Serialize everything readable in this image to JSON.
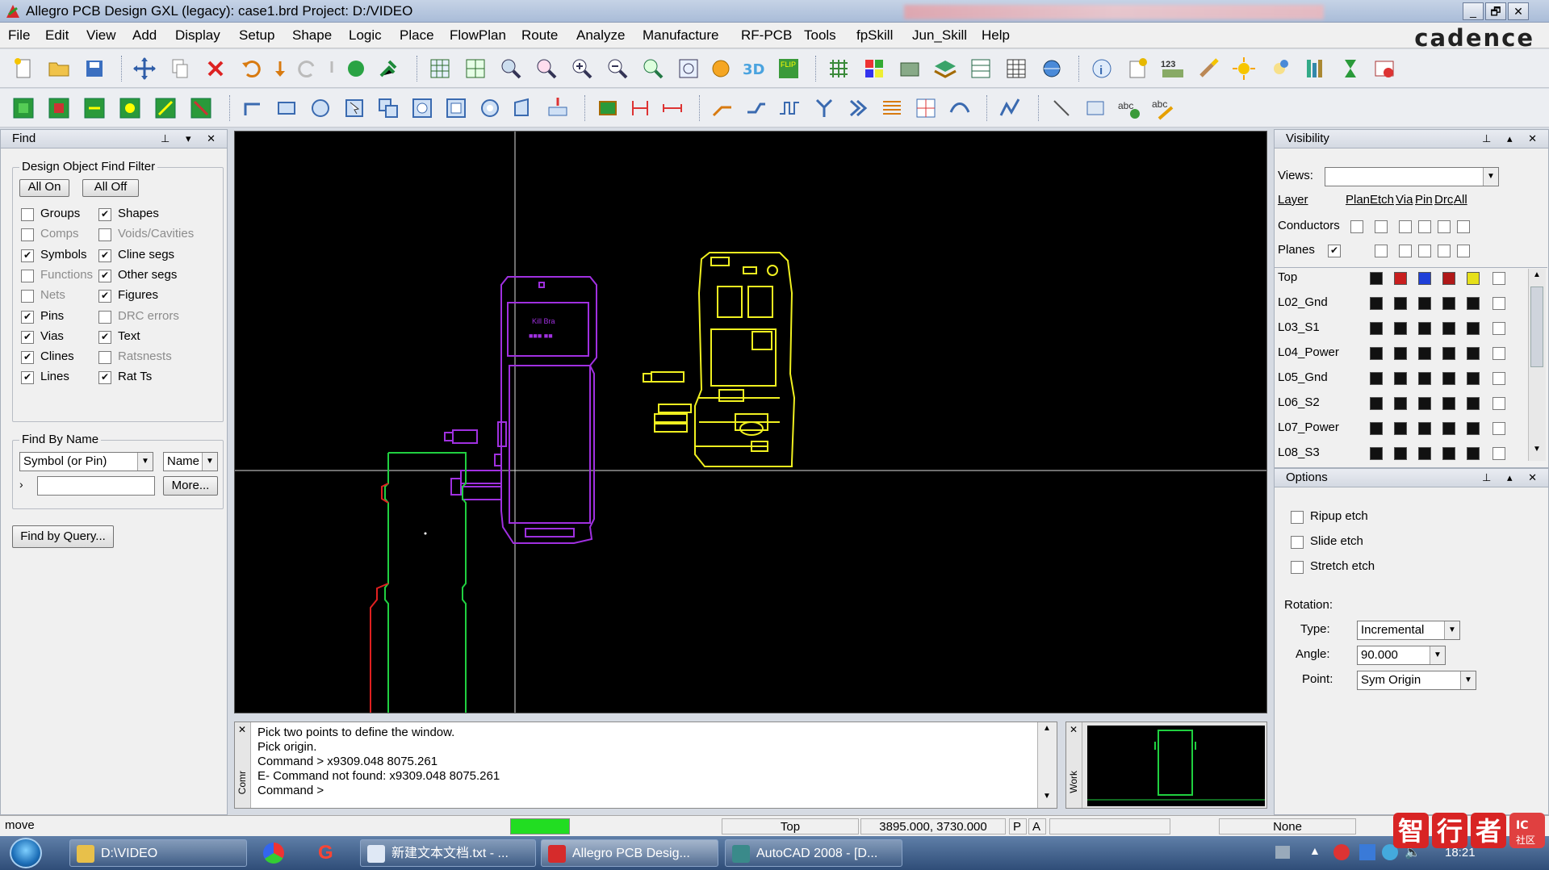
{
  "window": {
    "title": "Allegro PCB Design GXL (legacy): case1.brd  Project: D:/VIDEO",
    "icon": "allegro-icon",
    "controls": [
      "_",
      "🗗",
      "✕"
    ]
  },
  "menubar": {
    "items": [
      "File",
      "Edit",
      "View",
      "Add",
      "Display",
      "Setup",
      "Shape",
      "Logic",
      "Place",
      "FlowPlan",
      "Route",
      "Analyze",
      "Manufacture",
      "RF-PCB",
      "Tools",
      "fpSkill",
      "Jun_Skill",
      "Help"
    ],
    "brand": "cadence"
  },
  "find_panel": {
    "title": "Find",
    "filter_group": "Design Object Find Filter",
    "all_on": "All On",
    "all_off": "All Off",
    "left_items": [
      {
        "label": "Groups",
        "checked": false,
        "enabled": true
      },
      {
        "label": "Comps",
        "checked": false,
        "enabled": false
      },
      {
        "label": "Symbols",
        "checked": true,
        "enabled": true
      },
      {
        "label": "Functions",
        "checked": false,
        "enabled": false
      },
      {
        "label": "Nets",
        "checked": false,
        "enabled": false
      },
      {
        "label": "Pins",
        "checked": true,
        "enabled": true
      },
      {
        "label": "Vias",
        "checked": true,
        "enabled": true
      },
      {
        "label": "Clines",
        "checked": true,
        "enabled": true
      },
      {
        "label": "Lines",
        "checked": true,
        "enabled": true
      }
    ],
    "right_items": [
      {
        "label": "Shapes",
        "checked": true,
        "enabled": true
      },
      {
        "label": "Voids/Cavities",
        "checked": false,
        "enabled": false
      },
      {
        "label": "Cline segs",
        "checked": true,
        "enabled": true
      },
      {
        "label": "Other segs",
        "checked": true,
        "enabled": true
      },
      {
        "label": "Figures",
        "checked": true,
        "enabled": true
      },
      {
        "label": "DRC errors",
        "checked": false,
        "enabled": false
      },
      {
        "label": "Text",
        "checked": true,
        "enabled": true
      },
      {
        "label": "Ratsnests",
        "checked": false,
        "enabled": false
      },
      {
        "label": "Rat Ts",
        "checked": true,
        "enabled": true
      }
    ],
    "by_name_group": "Find By Name",
    "type_select": "Symbol (or Pin)",
    "name_select": "Name",
    "name_input": "",
    "more_button": "More...",
    "query_button": "Find by Query..."
  },
  "visibility_panel": {
    "title": "Visibility",
    "views_label": "Views:",
    "views_value": "",
    "columns": [
      "Layer",
      "Plan",
      "Etch",
      "Via",
      "Pin",
      "Drc",
      "All"
    ],
    "conductors_label": "Conductors",
    "planes_label": "Planes",
    "layers": [
      {
        "name": "Top",
        "colors": [
          "#111111",
          "#c81e1e",
          "#1f3fd8",
          "#b01818",
          "#e6e01a"
        ]
      },
      {
        "name": "L02_Gnd",
        "colors": [
          "#111111",
          "#111111",
          "#111111",
          "#111111",
          "#111111"
        ]
      },
      {
        "name": "L03_S1",
        "colors": [
          "#111111",
          "#111111",
          "#111111",
          "#111111",
          "#111111"
        ]
      },
      {
        "name": "L04_Power",
        "colors": [
          "#111111",
          "#111111",
          "#111111",
          "#111111",
          "#111111"
        ]
      },
      {
        "name": "L05_Gnd",
        "colors": [
          "#111111",
          "#111111",
          "#111111",
          "#111111",
          "#111111"
        ]
      },
      {
        "name": "L06_S2",
        "colors": [
          "#111111",
          "#111111",
          "#111111",
          "#111111",
          "#111111"
        ]
      },
      {
        "name": "L07_Power",
        "colors": [
          "#111111",
          "#111111",
          "#111111",
          "#111111",
          "#111111"
        ]
      },
      {
        "name": "L08_S3",
        "colors": [
          "#111111",
          "#111111",
          "#111111",
          "#111111",
          "#111111"
        ]
      }
    ]
  },
  "options_panel": {
    "title": "Options",
    "checks": [
      "Ripup etch",
      "Slide etch",
      "Stretch etch"
    ],
    "rotation_label": "Rotation:",
    "type_label": "Type:",
    "type_value": "Incremental",
    "angle_label": "Angle:",
    "angle_value": "90.000",
    "point_label": "Point:",
    "point_value": "Sym Origin"
  },
  "command": {
    "side_label": "Comr",
    "lines": [
      "Pick two points to define the window.",
      "Pick origin.",
      "Command > x9309.048 8075.261",
      "E- Command not found: x9309.048 8075.261",
      "Command >"
    ],
    "world_label": "Work"
  },
  "status": {
    "mode": "move",
    "indicator_color": "#22dd22",
    "layer": "Top",
    "coords": "3895.000, 3730.000",
    "p_flag": "P",
    "a_flag": "A",
    "dynamic": "None"
  },
  "taskbar": {
    "items": [
      {
        "label": "D:\\VIDEO",
        "active": false
      },
      {
        "label": "新建文本文档.txt - ...",
        "active": false
      },
      {
        "label": "Allegro PCB Desig...",
        "active": true
      },
      {
        "label": "AutoCAD 2008 - [D...",
        "active": false
      }
    ],
    "clock": "18:21",
    "watermark": [
      "智",
      "行",
      "者",
      "IC社区"
    ]
  },
  "colors": {
    "canvas_bg": "#000000",
    "board_purple": "#a030e0",
    "board_yellow": "#f0f020",
    "outline_green": "#20d040",
    "outline_red": "#e02020"
  }
}
